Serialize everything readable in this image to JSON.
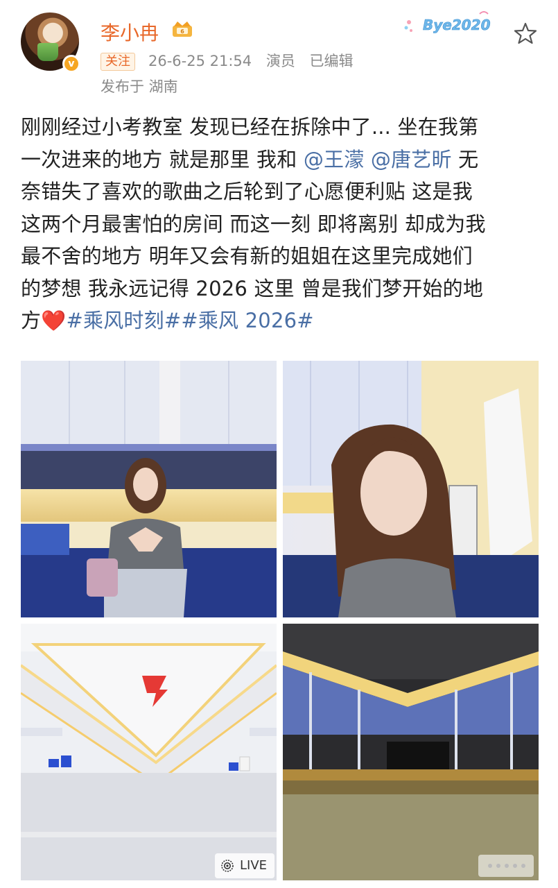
{
  "user": {
    "name": "李小冉",
    "follow_label": "关注",
    "timestamp": "26-6-25 21:54",
    "role": "演员",
    "edited": "已编辑",
    "location": "发布于 湖南"
  },
  "badge": {
    "text": "Bye2020"
  },
  "post": {
    "lines": [
      [
        {
          "t": "text",
          "v": "刚刚经过小考教室 发现已经在拆除中了... 坐在我第"
        }
      ],
      [
        {
          "t": "text",
          "v": "一次进来的地方 就是那里 我和 "
        },
        {
          "t": "mention",
          "v": "@王濛"
        },
        {
          "t": "text",
          "v": " "
        },
        {
          "t": "mention",
          "v": "@唐艺昕"
        },
        {
          "t": "text",
          "v": " 无"
        }
      ],
      [
        {
          "t": "text",
          "v": "奈错失了喜欢的歌曲之后轮到了心愿便利贴 这是我"
        }
      ],
      [
        {
          "t": "text",
          "v": "这两个月最害怕的房间 而这一刻 即将离别 却成为我"
        }
      ],
      [
        {
          "t": "text",
          "v": "最不舍的地方 明年又会有新的姐姐在这里完成她们"
        }
      ],
      [
        {
          "t": "text",
          "v": "的梦想 我永远记得 2026 这里 曾是我们梦开始的地"
        }
      ],
      [
        {
          "t": "text",
          "v": "方"
        },
        {
          "t": "heart",
          "v": "❤️"
        },
        {
          "t": "hashtag",
          "v": "#乘风时刻#"
        },
        {
          "t": "hashtag",
          "v": "#乘风 2026#"
        }
      ]
    ]
  },
  "photos": [
    {
      "name": "photo-woman-heart-gesture"
    },
    {
      "name": "photo-woman-selfie"
    },
    {
      "name": "photo-empty-stage-logo"
    },
    {
      "name": "photo-empty-stage-wide"
    }
  ],
  "live_label": "LIVE",
  "icons": {
    "favorite": "star-outline-icon",
    "verified": "verified-v-icon",
    "vip": "vip-crown-icon",
    "live": "live-icon"
  },
  "colors": {
    "username": "#e8682a",
    "link": "#4a6fa5",
    "meta": "#8a8a8a",
    "verified": "#f6a623"
  }
}
